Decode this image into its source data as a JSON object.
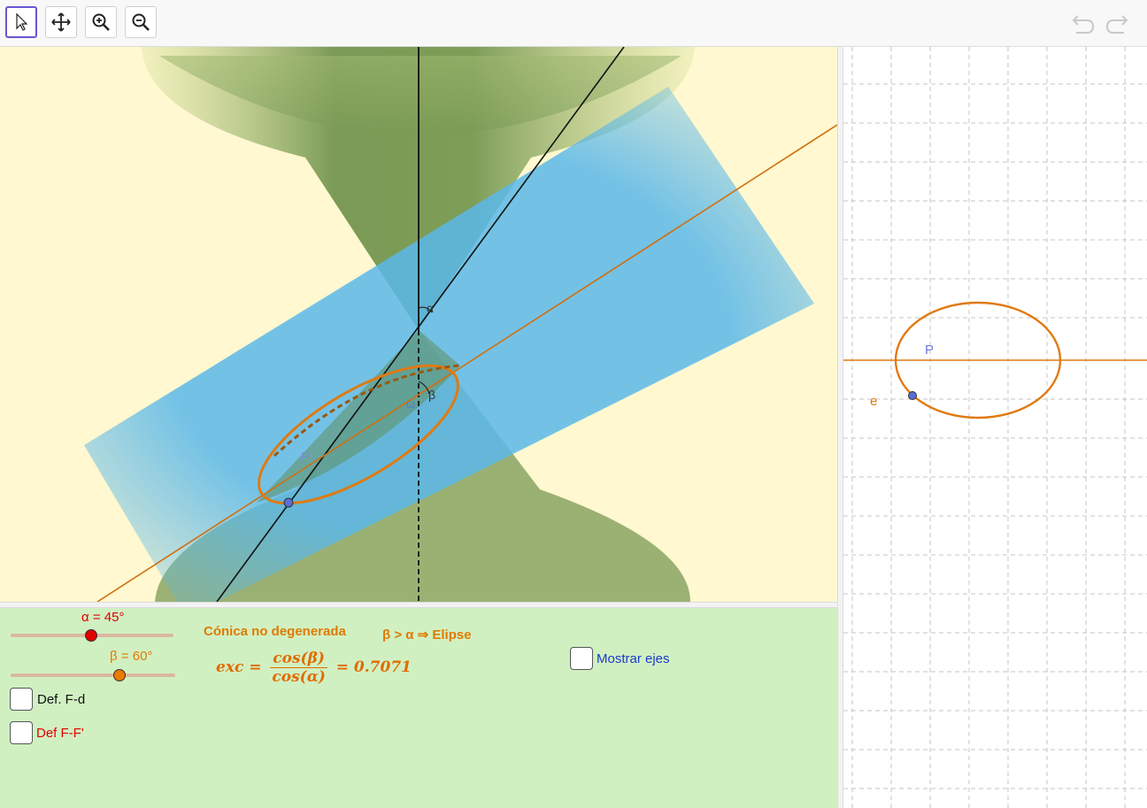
{
  "toolbar": {
    "tools": [
      {
        "name": "move-tool-button",
        "icon": "arrow-pointer-icon",
        "selected": true
      },
      {
        "name": "move-view-tool-button",
        "icon": "move-arrows-icon"
      },
      {
        "name": "zoom-in-tool-button",
        "icon": "zoom-in-icon"
      },
      {
        "name": "zoom-out-tool-button",
        "icon": "zoom-out-icon"
      }
    ],
    "undo_icon": "undo-icon",
    "redo_icon": "redo-icon"
  },
  "view3d": {
    "background": "#fff8d0",
    "label_alpha": "α",
    "label_beta": "β",
    "label_omega": "ω",
    "label_point": "P",
    "colors": {
      "cone": "#7a9a55",
      "plane": "#5ab8ea",
      "conic": "#e07a10",
      "point": "#5a6ed6"
    }
  },
  "panel": {
    "background": "#d1f0c2",
    "slider_alpha": {
      "label": "α = 45°",
      "value": 45,
      "color": "#e00000"
    },
    "slider_beta": {
      "label": "β = 60°",
      "value": 60,
      "color": "#ea7a00"
    },
    "conic_type_text": "Cónica no degenerada",
    "condition_text": "β  >  α  ⇒   Elipse",
    "formula": {
      "lhs": "exc",
      "num": "cos(β)",
      "den": "cos(α)",
      "rhs": "= 0.7071"
    },
    "checkbox_fd": {
      "label": "Def. F-d",
      "checked": false
    },
    "checkbox_ff": {
      "label": "Def  F-F'",
      "checked": false
    },
    "checkbox_axes": {
      "label": "Mostrar ejes",
      "checked": false
    }
  },
  "view2d": {
    "label_point": "P",
    "label_e": "e",
    "colors": {
      "ellipse": "#e07a10",
      "line": "#e07a10",
      "point": "#5a6ed6",
      "grid": "#c0c0c0"
    }
  }
}
